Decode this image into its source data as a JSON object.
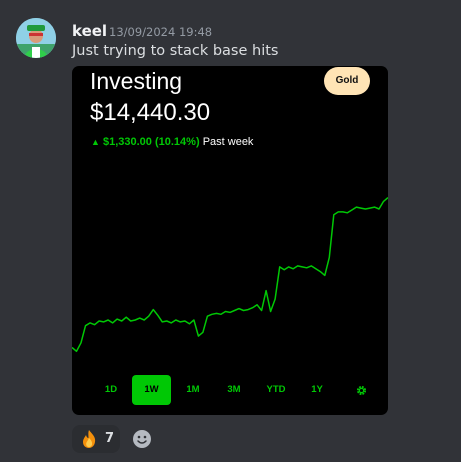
{
  "message": {
    "username": "keel",
    "timestamp": "13/09/2024 19:48",
    "content": "Just trying to stack base hits"
  },
  "embed": {
    "title": "Investing",
    "badge": "Gold",
    "balance": "$14,440.30",
    "change_amount": "$1,330.00 (10.14%)",
    "change_period": "Past week",
    "accent_color": "#00c805",
    "ranges": [
      "1D",
      "1W",
      "1M",
      "3M",
      "YTD",
      "1Y"
    ],
    "active_range": "1W",
    "settings_icon": "gear-icon"
  },
  "chart_data": {
    "type": "line",
    "color": "#00c805",
    "values": [
      12900,
      12860,
      12950,
      13130,
      13160,
      13140,
      13180,
      13170,
      13190,
      13160,
      13200,
      13180,
      13220,
      13180,
      13190,
      13210,
      13190,
      13230,
      13300,
      13240,
      13170,
      13180,
      13160,
      13190,
      13170,
      13180,
      13150,
      13190,
      13020,
      13060,
      13230,
      13250,
      13260,
      13250,
      13280,
      13270,
      13290,
      13310,
      13290,
      13300,
      13320,
      13350,
      13290,
      13500,
      13280,
      13410,
      13750,
      13720,
      13750,
      13730,
      13760,
      13750,
      13740,
      13760,
      13730,
      13700,
      13660,
      13850,
      14300,
      14330,
      14330,
      14320,
      14350,
      14380,
      14370,
      14360,
      14370,
      14380,
      14360,
      14440,
      14480
    ],
    "ylim": [
      12800,
      14550
    ],
    "grid": false,
    "axes_visible": false
  },
  "reactions": [
    {
      "emoji": "fire-icon",
      "count": "7"
    }
  ],
  "add_reaction_icon": "add-reaction-icon"
}
